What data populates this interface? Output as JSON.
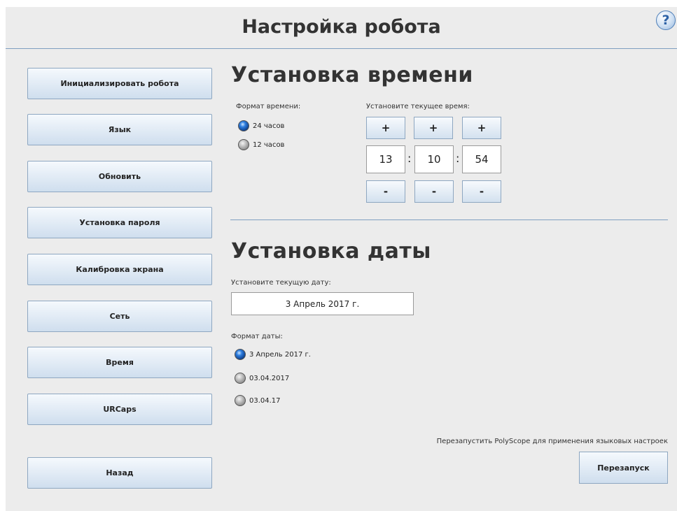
{
  "header": {
    "title": "Настройка робота",
    "help_symbol": "?"
  },
  "sidebar": {
    "items": [
      {
        "label": "Инициализировать робота"
      },
      {
        "label": "Язык"
      },
      {
        "label": "Обновить"
      },
      {
        "label": "Установка пароля"
      },
      {
        "label": "Калибровка экрана"
      },
      {
        "label": "Сеть"
      },
      {
        "label": "Время"
      },
      {
        "label": "URCaps"
      }
    ],
    "back_label": "Назад"
  },
  "time_section": {
    "title": "Установка времени",
    "format_label": "Формат времени:",
    "format_options": [
      {
        "label": "24 часов",
        "selected": true
      },
      {
        "label": "12 часов",
        "selected": false
      }
    ],
    "set_label": "Установите текущее время:",
    "plus": "+",
    "minus": "-",
    "separator": ":",
    "hours": "13",
    "minutes": "10",
    "seconds": "54"
  },
  "date_section": {
    "title": "Установка даты",
    "set_label": "Установите текущую дату:",
    "current_date": "3 Апрель 2017 г.",
    "format_label": "Формат даты:",
    "format_options": [
      {
        "label": "3 Апрель 2017 г.",
        "selected": true
      },
      {
        "label": "03.04.2017",
        "selected": false
      },
      {
        "label": "03.04.17",
        "selected": false
      }
    ]
  },
  "footer": {
    "restart_note": "Перезапустить PolyScope для применения языковых настроек",
    "restart_label": "Перезапуск"
  },
  "colors": {
    "accent_line": "#7f9fc0",
    "button_border": "#8ea7c1",
    "background": "#ececec"
  }
}
